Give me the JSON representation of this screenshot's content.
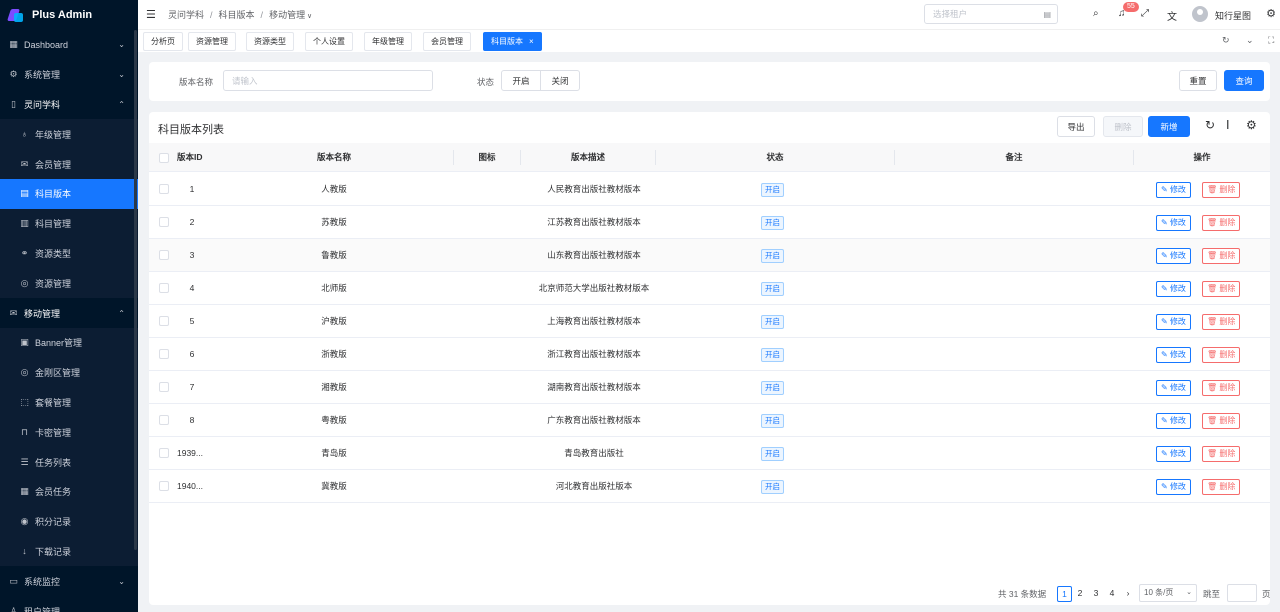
{
  "app": {
    "title": "Plus Admin"
  },
  "sidebar": {
    "items": [
      {
        "label": "Dashboard",
        "icon": "grid-icon",
        "arrow": "⌄"
      },
      {
        "label": "系统管理",
        "icon": "settings-icon",
        "arrow": "⌄"
      },
      {
        "label": "灵问学科",
        "icon": "document-icon",
        "arrow": "⌃"
      },
      {
        "label": "年级管理",
        "icon": "bell-icon",
        "sub": true
      },
      {
        "label": "会员管理",
        "icon": "chat-icon",
        "sub": true
      },
      {
        "label": "科目版本",
        "icon": "form-icon",
        "sub": true,
        "active": true
      },
      {
        "label": "科目管理",
        "icon": "table-icon",
        "sub": true
      },
      {
        "label": "资源类型",
        "icon": "link-icon",
        "sub": true
      },
      {
        "label": "资源管理",
        "icon": "globe-icon",
        "sub": true
      },
      {
        "label": "移动管理",
        "icon": "chat-icon",
        "arrow": "⌃"
      },
      {
        "label": "Banner管理",
        "icon": "image-icon",
        "sub": true
      },
      {
        "label": "金刚区管理",
        "icon": "globe-icon",
        "sub": true
      },
      {
        "label": "套餐管理",
        "icon": "box-icon",
        "sub": true
      },
      {
        "label": "卡密管理",
        "icon": "lock-icon",
        "sub": true
      },
      {
        "label": "任务列表",
        "icon": "list-icon",
        "sub": true
      },
      {
        "label": "会员任务",
        "icon": "grid-icon",
        "sub": true
      },
      {
        "label": "积分记录",
        "icon": "coin-icon",
        "sub": true
      },
      {
        "label": "下载记录",
        "icon": "download-icon",
        "sub": true
      },
      {
        "label": "系统监控",
        "icon": "monitor-icon",
        "arrow": "⌄"
      },
      {
        "label": "租户管理",
        "icon": "users-icon",
        "arrow": "⌄"
      }
    ]
  },
  "topbar": {
    "breadcrumb": [
      "灵问学科",
      "科目版本",
      "移动管理"
    ],
    "tenant_placeholder": "选择租户",
    "notification_count": "55",
    "username": "知行星图"
  },
  "tabs": [
    {
      "label": "分析页"
    },
    {
      "label": "资源管理"
    },
    {
      "label": "资源类型"
    },
    {
      "label": "个人设置"
    },
    {
      "label": "年级管理"
    },
    {
      "label": "会员管理"
    },
    {
      "label": "科目版本",
      "active": true,
      "close": "×"
    }
  ],
  "search": {
    "name_label": "版本名称",
    "name_placeholder": "请输入",
    "status_label": "状态",
    "status_options": [
      "开启",
      "关闭"
    ],
    "reset_label": "重置",
    "query_label": "查询"
  },
  "table": {
    "title": "科目版本列表",
    "export_label": "导出",
    "delete_label": "删除",
    "add_label": "新增",
    "columns": [
      "版本ID",
      "版本名称",
      "图标",
      "版本描述",
      "状态",
      "备注",
      "操作"
    ],
    "rows": [
      {
        "id": "1",
        "name": "人教版",
        "desc": "人民教育出版社教材版本",
        "status": "开启"
      },
      {
        "id": "2",
        "name": "苏教版",
        "desc": "江苏教育出版社教材版本",
        "status": "开启"
      },
      {
        "id": "3",
        "name": "鲁教版",
        "desc": "山东教育出版社教材版本",
        "status": "开启"
      },
      {
        "id": "4",
        "name": "北师版",
        "desc": "北京师范大学出版社教材版本",
        "status": "开启"
      },
      {
        "id": "5",
        "name": "沪教版",
        "desc": "上海教育出版社教材版本",
        "status": "开启"
      },
      {
        "id": "6",
        "name": "浙教版",
        "desc": "浙江教育出版社教材版本",
        "status": "开启"
      },
      {
        "id": "7",
        "name": "湘教版",
        "desc": "湖南教育出版社教材版本",
        "status": "开启"
      },
      {
        "id": "8",
        "name": "粤教版",
        "desc": "广东教育出版社教材版本",
        "status": "开启"
      },
      {
        "id": "1939...",
        "name": "青岛版",
        "desc": "青岛教育出版社",
        "status": "开启"
      },
      {
        "id": "1940...",
        "name": "冀教版",
        "desc": "河北教育出版社版本",
        "status": "开启"
      }
    ],
    "edit_label": "修改",
    "row_delete_label": "删除"
  },
  "pagination": {
    "total_text": "共 31 条数据",
    "pages": [
      "1",
      "2",
      "3",
      "4"
    ],
    "current": "1",
    "page_size": "10 条/页",
    "jump_label": "跳至",
    "page_suffix": "页"
  },
  "colors": {
    "primary": "#1677ff",
    "sidebar_bg": "#001529",
    "danger": "#f56c6c"
  }
}
